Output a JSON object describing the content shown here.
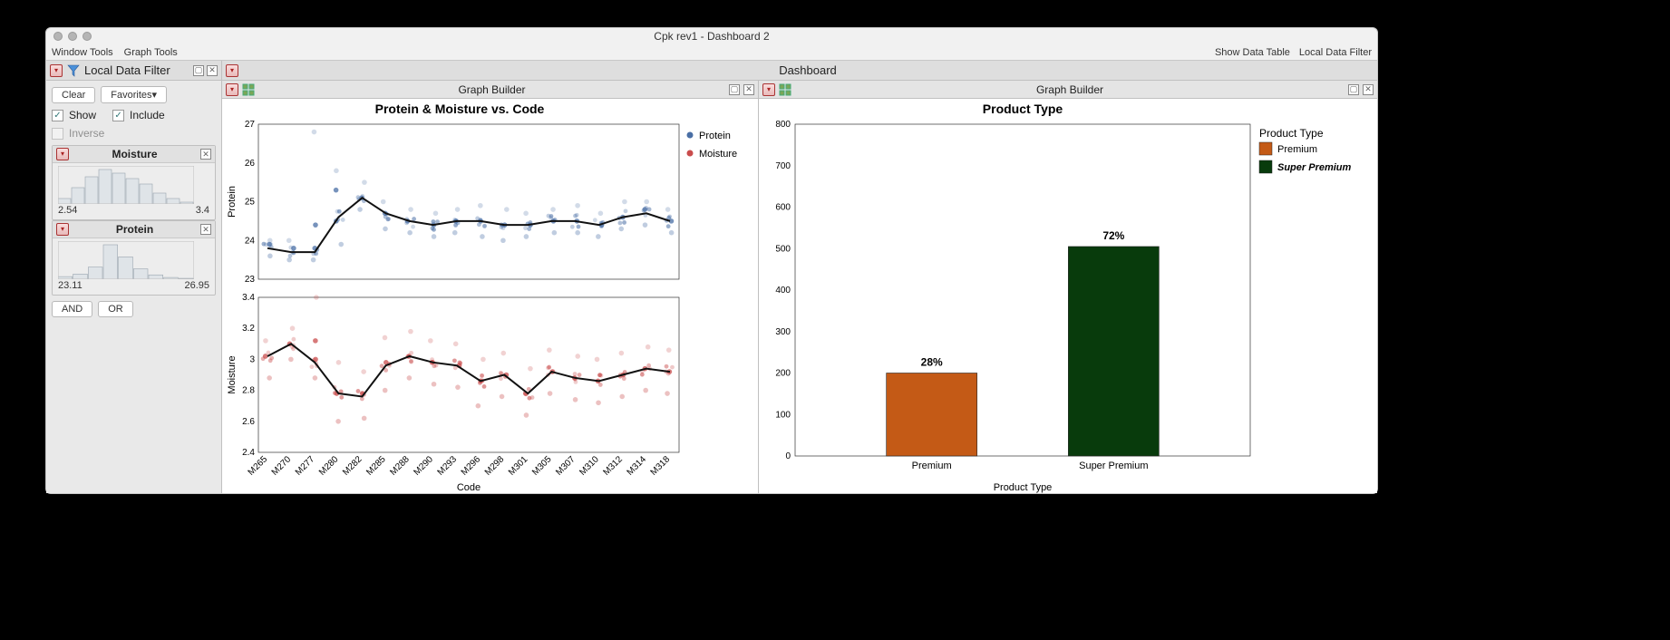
{
  "window": {
    "title": "Cpk rev1 - Dashboard 2"
  },
  "menu": {
    "window_tools": "Window Tools",
    "graph_tools": "Graph Tools",
    "show_data_table": "Show Data Table",
    "local_data_filter": "Local Data Filter"
  },
  "filter_panel": {
    "title": "Local Data Filter",
    "clear": "Clear",
    "favorites": "Favorites▾",
    "show": "Show",
    "include": "Include",
    "inverse": "Inverse",
    "and": "AND",
    "or": "OR",
    "cards": [
      {
        "name": "Moisture",
        "min": "2.54",
        "max": "3.4",
        "bins": [
          6,
          18,
          30,
          38,
          34,
          28,
          22,
          12,
          6,
          2
        ]
      },
      {
        "name": "Protein",
        "min": "23.11",
        "max": "26.95",
        "bins": [
          3,
          6,
          14,
          40,
          26,
          12,
          5,
          2,
          1
        ]
      }
    ]
  },
  "dashboard": {
    "title": "Dashboard",
    "graph_builder": "Graph Builder"
  },
  "chart_data": [
    {
      "type": "scatter",
      "title": "Protein & Moisture vs. Code",
      "xlabel": "Code",
      "categories": [
        "M265",
        "M270",
        "M277",
        "M280",
        "M282",
        "M285",
        "M288",
        "M290",
        "M293",
        "M296",
        "M298",
        "M301",
        "M305",
        "M307",
        "M310",
        "M312",
        "M314",
        "M318"
      ],
      "subplots": [
        {
          "ylabel": "Protein",
          "ylim": [
            23,
            27
          ],
          "yticks": [
            23,
            24,
            25,
            26,
            27
          ],
          "series_name": "Protein",
          "series_color": "#4a6fa5",
          "smooth": [
            23.8,
            23.7,
            23.7,
            24.6,
            25.1,
            24.7,
            24.5,
            24.4,
            24.5,
            24.5,
            24.4,
            24.4,
            24.5,
            24.5,
            24.4,
            24.6,
            24.7,
            24.5
          ],
          "scatter": [
            [
              23.6,
              23.9,
              24.0
            ],
            [
              23.5,
              23.8,
              24.0
            ],
            [
              23.5,
              23.8,
              24.4,
              26.8
            ],
            [
              23.9,
              24.5,
              25.3,
              25.8
            ],
            [
              24.8,
              25.1,
              25.5
            ],
            [
              24.3,
              24.7,
              25.0
            ],
            [
              24.2,
              24.5,
              24.8
            ],
            [
              24.1,
              24.4,
              24.7
            ],
            [
              24.2,
              24.5,
              24.8
            ],
            [
              24.1,
              24.5,
              24.9
            ],
            [
              24.0,
              24.4,
              24.8
            ],
            [
              24.1,
              24.4,
              24.7
            ],
            [
              24.2,
              24.5,
              24.8
            ],
            [
              24.2,
              24.5,
              24.9
            ],
            [
              24.1,
              24.4,
              24.7
            ],
            [
              24.3,
              24.6,
              25.0
            ],
            [
              24.4,
              24.8,
              25.0
            ],
            [
              24.2,
              24.5,
              24.8
            ]
          ]
        },
        {
          "ylabel": "Moisture",
          "ylim": [
            2.4,
            3.4
          ],
          "yticks": [
            2.4,
            2.6,
            2.8,
            3.0,
            3.2,
            3.4
          ],
          "series_name": "Moisture",
          "series_color": "#c94c4c",
          "smooth": [
            3.02,
            3.1,
            2.98,
            2.78,
            2.76,
            2.96,
            3.02,
            2.98,
            2.96,
            2.86,
            2.9,
            2.78,
            2.92,
            2.88,
            2.86,
            2.9,
            2.94,
            2.92
          ],
          "scatter": [
            [
              2.88,
              3.02,
              3.12
            ],
            [
              3.0,
              3.1,
              3.2
            ],
            [
              2.88,
              3.0,
              3.12,
              3.4
            ],
            [
              2.6,
              2.78,
              2.98
            ],
            [
              2.62,
              2.78,
              2.92
            ],
            [
              2.8,
              2.98,
              3.14
            ],
            [
              2.88,
              3.02,
              3.18
            ],
            [
              2.84,
              2.98,
              3.12
            ],
            [
              2.82,
              2.96,
              3.1
            ],
            [
              2.7,
              2.86,
              3.0
            ],
            [
              2.76,
              2.9,
              3.04
            ],
            [
              2.64,
              2.78,
              2.94
            ],
            [
              2.78,
              2.92,
              3.06
            ],
            [
              2.74,
              2.88,
              3.02
            ],
            [
              2.72,
              2.86,
              3.0
            ],
            [
              2.76,
              2.9,
              3.04
            ],
            [
              2.8,
              2.94,
              3.08
            ],
            [
              2.78,
              2.92,
              3.06
            ]
          ]
        }
      ],
      "legend": [
        "Protein",
        "Moisture"
      ],
      "legend_colors": [
        "#4a6fa5",
        "#c94c4c"
      ]
    },
    {
      "type": "bar",
      "title": "Product Type",
      "xlabel": "Product Type",
      "ylabel": "",
      "ylim": [
        0,
        800
      ],
      "yticks": [
        0,
        100,
        200,
        300,
        400,
        500,
        600,
        700,
        800
      ],
      "categories": [
        "Premium",
        "Super Premium"
      ],
      "values": [
        200,
        505
      ],
      "labels": [
        "28%",
        "72%"
      ],
      "colors": [
        "#c45a16",
        "#083b0c"
      ],
      "legend_title": "Product Type",
      "legend": [
        "Premium",
        "Super Premium"
      ]
    }
  ]
}
